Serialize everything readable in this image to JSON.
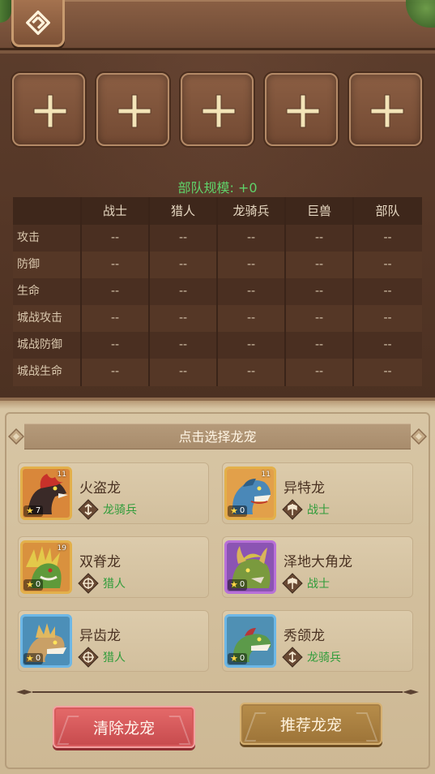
{
  "troop_size": "部队规模: +0",
  "slots": [
    {
      "id": 1
    },
    {
      "id": 2
    },
    {
      "id": 3
    },
    {
      "id": 4
    },
    {
      "id": 5
    }
  ],
  "stats": {
    "columns": [
      "战士",
      "猎人",
      "龙骑兵",
      "巨兽",
      "部队"
    ],
    "rows": [
      {
        "label": "攻击",
        "values": [
          "--",
          "--",
          "--",
          "--",
          "--"
        ]
      },
      {
        "label": "防御",
        "values": [
          "--",
          "--",
          "--",
          "--",
          "--"
        ]
      },
      {
        "label": "生命",
        "values": [
          "--",
          "--",
          "--",
          "--",
          "--"
        ]
      },
      {
        "label": "城战攻击",
        "values": [
          "--",
          "--",
          "--",
          "--",
          "--"
        ]
      },
      {
        "label": "城战防御",
        "values": [
          "--",
          "--",
          "--",
          "--",
          "--"
        ]
      },
      {
        "label": "城战生命",
        "values": [
          "--",
          "--",
          "--",
          "--",
          "--"
        ]
      }
    ]
  },
  "section_title": "点击选择龙宠",
  "pets": [
    {
      "name": "火盗龙",
      "type": "龙骑兵",
      "level": "11",
      "stars": "7",
      "frame": "gold"
    },
    {
      "name": "异特龙",
      "type": "战士",
      "level": "11",
      "stars": "0",
      "frame": "gold"
    },
    {
      "name": "双脊龙",
      "type": "猎人",
      "level": "19",
      "stars": "0",
      "frame": "gold"
    },
    {
      "name": "泽地大角龙",
      "type": "战士",
      "level": "",
      "stars": "0",
      "frame": "purple"
    },
    {
      "name": "异齿龙",
      "type": "猎人",
      "level": "",
      "stars": "0",
      "frame": "blue"
    },
    {
      "name": "秀颌龙",
      "type": "龙骑兵",
      "level": "",
      "stars": "0",
      "frame": "blue"
    }
  ],
  "buttons": {
    "clear": "清除龙宠",
    "recommend": "推荐龙宠"
  },
  "colors": {
    "troop_size_green": "#5fd36a",
    "type_green": "#2f9c3a",
    "clear_red": "#d9585b",
    "recommend_gold": "#ab8041"
  }
}
